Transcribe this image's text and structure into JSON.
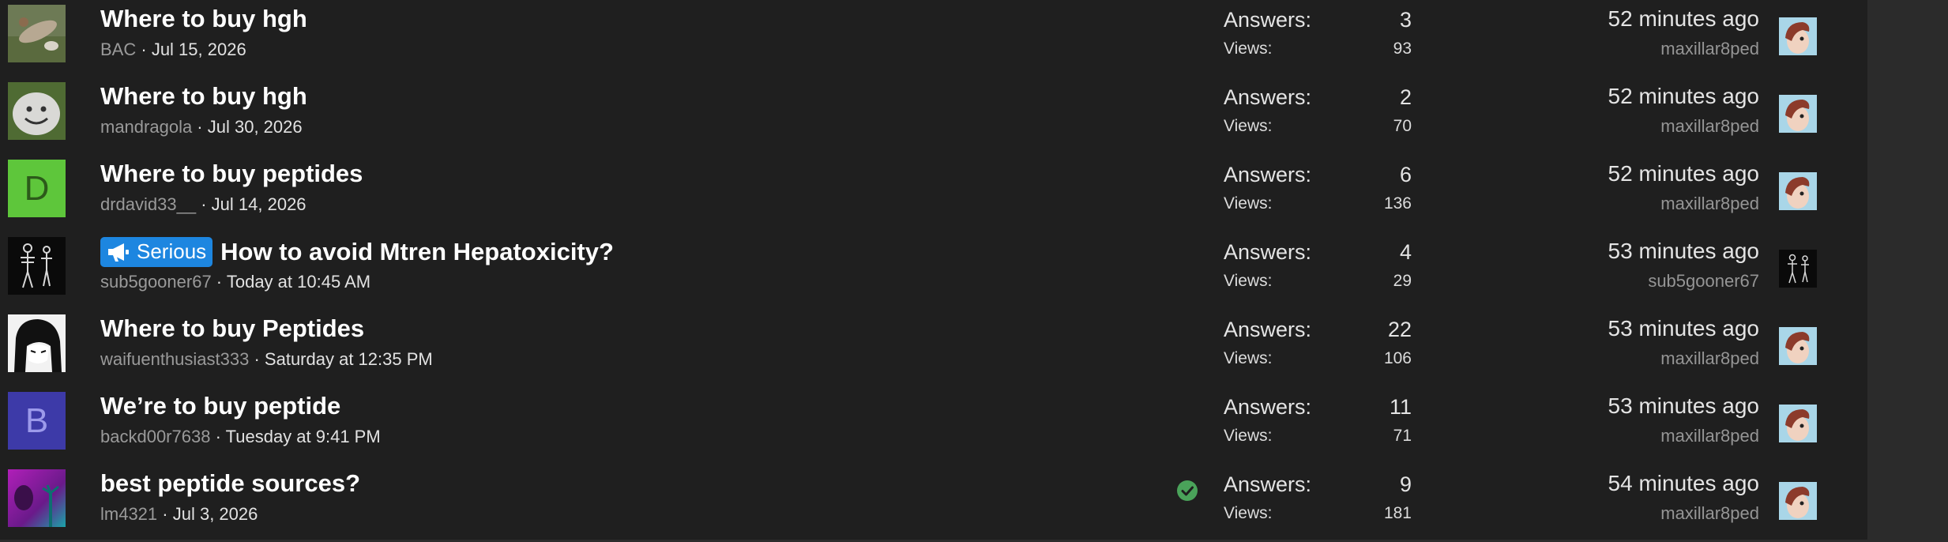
{
  "threads": [
    {
      "title": "Where to buy hgh",
      "author": "BAC",
      "date": "Jul 15, 2026",
      "answers_label": "Answers:",
      "answers": "3",
      "views_label": "Views:",
      "views": "93",
      "last_time": "52 minutes ago",
      "last_user": "maxillar8ped",
      "avatar_icon": "photo-avatar-icon",
      "last_avatar_icon": "cartoon-face-avatar-icon"
    },
    {
      "title": "Where to buy hgh",
      "author": "mandragola",
      "date": "Jul 30, 2026",
      "answers_label": "Answers:",
      "answers": "2",
      "views_label": "Views:",
      "views": "70",
      "last_time": "52 minutes ago",
      "last_user": "maxillar8ped",
      "avatar_icon": "smiley-stone-avatar-icon",
      "last_avatar_icon": "cartoon-face-avatar-icon"
    },
    {
      "title": "Where to buy peptides",
      "author": "drdavid33__",
      "date": "Jul 14, 2026",
      "answers_label": "Answers:",
      "answers": "6",
      "views_label": "Views:",
      "views": "136",
      "last_time": "52 minutes ago",
      "last_user": "maxillar8ped",
      "avatar_letter": "D",
      "avatar_bg": "#5ec63b",
      "avatar_fg": "#2c5a1a",
      "last_avatar_icon": "cartoon-face-avatar-icon"
    },
    {
      "prefix": "Serious",
      "prefix_icon": "megaphone-icon",
      "title": "How to avoid Mtren Hepatoxicity?",
      "author": "sub5gooner67",
      "date": "Today at 10:45 AM",
      "answers_label": "Answers:",
      "answers": "4",
      "views_label": "Views:",
      "views": "29",
      "last_time": "53 minutes ago",
      "last_user": "sub5gooner67",
      "avatar_icon": "skeleton-avatar-icon",
      "last_avatar_icon": "skeleton-avatar-icon"
    },
    {
      "title": "Where to buy Peptides",
      "author": "waifuenthusiast333",
      "date": "Saturday at 12:35 PM",
      "answers_label": "Answers:",
      "answers": "22",
      "views_label": "Views:",
      "views": "106",
      "last_time": "53 minutes ago",
      "last_user": "maxillar8ped",
      "avatar_icon": "anime-girl-avatar-icon",
      "last_avatar_icon": "cartoon-face-avatar-icon"
    },
    {
      "title": "We’re to buy peptide",
      "author": "backd00r7638",
      "date": "Tuesday at 9:41 PM",
      "answers_label": "Answers:",
      "answers": "11",
      "views_label": "Views:",
      "views": "71",
      "last_time": "53 minutes ago",
      "last_user": "maxillar8ped",
      "avatar_letter": "B",
      "avatar_bg": "#3d3aa8",
      "avatar_fg": "#9c9aeb",
      "last_avatar_icon": "cartoon-face-avatar-icon"
    },
    {
      "title": "best peptide sources?",
      "author": "lm4321",
      "date": "Jul 3, 2026",
      "solved": true,
      "solved_icon": "check-circle-icon",
      "answers_label": "Answers:",
      "answers": "9",
      "views_label": "Views:",
      "views": "181",
      "last_time": "54 minutes ago",
      "last_user": "maxillar8ped",
      "avatar_icon": "vaporwave-avatar-icon",
      "last_avatar_icon": "cartoon-face-avatar-icon"
    }
  ],
  "meta_separator": " · ",
  "colors": {
    "panel_bg": "#1f1f1f",
    "gutter_bg": "#2b2b2b",
    "prefix_bg": "#1d86e0",
    "solved_green": "#4aa35a"
  }
}
